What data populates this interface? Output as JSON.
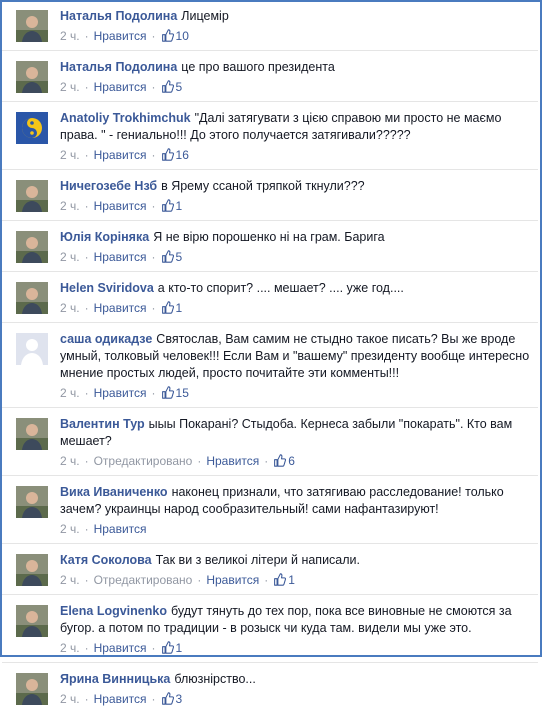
{
  "colors": {
    "link": "#3b5998",
    "meta": "#9197a3",
    "frame": "#4a7bbf"
  },
  "comments": [
    {
      "author": "Наталья Подолина",
      "text": "Лицемір",
      "time": "2 ч.",
      "like_label": "Нравится",
      "likes": "10",
      "edited": "",
      "avatar": "avatar-photo"
    },
    {
      "author": "Наталья Подолина",
      "text": "це про вашого президента",
      "time": "2 ч.",
      "like_label": "Нравится",
      "likes": "5",
      "edited": "",
      "avatar": "avatar-photo"
    },
    {
      "author": "Anatoliy Trokhimchuk",
      "text": "\"Далі затягувати з цією справою ми просто не маємо права. \" - гениально!!! До этого получается затягивали?????",
      "time": "2 ч.",
      "like_label": "Нравится",
      "likes": "16",
      "edited": "",
      "avatar": "avatar-yin-yang"
    },
    {
      "author": "Ничегозебе Нзб",
      "text": "в Ярему ссаной тряпкой ткнули???",
      "time": "2 ч.",
      "like_label": "Нравится",
      "likes": "1",
      "edited": "",
      "avatar": "avatar-photo"
    },
    {
      "author": "Юлія Коріняка",
      "text": "Я не вірю порошенко ні на грам. Барига",
      "time": "2 ч.",
      "like_label": "Нравится",
      "likes": "5",
      "edited": "",
      "avatar": "avatar-photo"
    },
    {
      "author": "Helen Sviridova",
      "text": "а кто-то спорит? .... мешает? .... уже год....",
      "time": "2 ч.",
      "like_label": "Нравится",
      "likes": "1",
      "edited": "",
      "avatar": "avatar-photo"
    },
    {
      "author": "саша одикадзе",
      "text": "Святослав, Вам самим не стыдно такое писать? Вы же вроде умный, толковый человек!!! Если Вам и \"вашему\" президенту вообще интересно мнение простых людей, просто почитайте эти комменты!!!",
      "time": "2 ч.",
      "like_label": "Нравится",
      "likes": "15",
      "edited": "",
      "avatar": "avatar-default"
    },
    {
      "author": "Валентин Тур",
      "text": "ыыы Покарані? Стыдоба. Кернеса забыли \"покарать\". Кто вам мешает?",
      "time": "2 ч.",
      "like_label": "Нравится",
      "likes": "6",
      "edited": "Отредактировано",
      "avatar": "avatar-photo"
    },
    {
      "author": "Вика Иваниченко",
      "text": "наконец признали, что затягиваю расследование! только зачем? украинцы народ сообразительный! сами нафантазируют!",
      "time": "2 ч.",
      "like_label": "Нравится",
      "likes": "",
      "edited": "",
      "avatar": "avatar-photo"
    },
    {
      "author": "Катя Соколова",
      "text": "Так ви з великоі літери й написали.",
      "time": "2 ч.",
      "like_label": "Нравится",
      "likes": "1",
      "edited": "Отредактировано",
      "avatar": "avatar-photo"
    },
    {
      "author": "Elena Logvinenko",
      "text": "будут тянуть до тех пор, пока все виновные не смоются за бугор. а потом по традиции - в розыск чи куда там. видели мы уже это.",
      "time": "2 ч.",
      "like_label": "Нравится",
      "likes": "1",
      "edited": "",
      "avatar": "avatar-photo"
    },
    {
      "author": "Ярина Винницька",
      "text": "блюзнірство...",
      "time": "2 ч.",
      "like_label": "Нравится",
      "likes": "3",
      "edited": "",
      "avatar": "avatar-photo"
    }
  ]
}
